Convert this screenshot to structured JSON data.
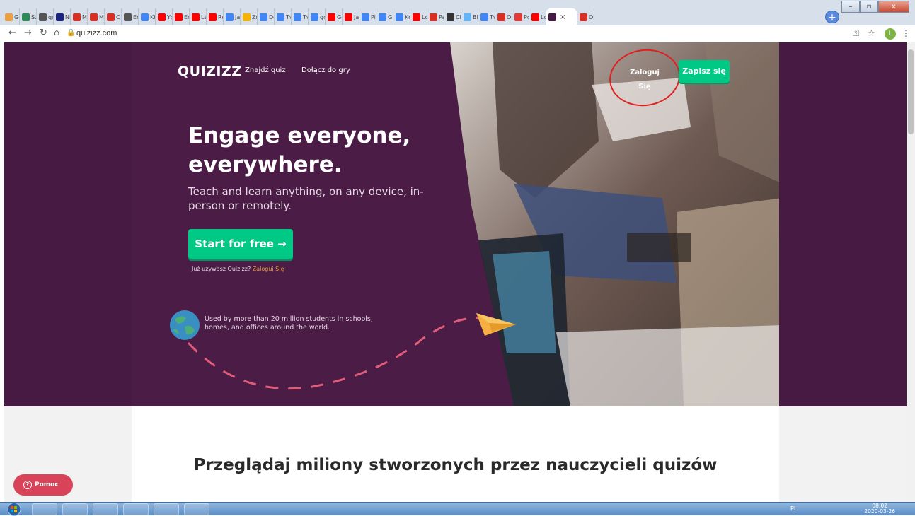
{
  "browser": {
    "tabs": [
      {
        "label": "Gc",
        "color": "#e8a040"
      },
      {
        "label": "Sz",
        "color": "#2e8b57"
      },
      {
        "label": "qu",
        "color": "#555555"
      },
      {
        "label": "Ni",
        "color": "#1a237e"
      },
      {
        "label": "M",
        "color": "#d93025"
      },
      {
        "label": "M",
        "color": "#d93025"
      },
      {
        "label": "Or",
        "color": "#d93025"
      },
      {
        "label": "En",
        "color": "#555555"
      },
      {
        "label": "Kt",
        "color": "#4285f4"
      },
      {
        "label": "Yc",
        "color": "#ff0000"
      },
      {
        "label": "En",
        "color": "#ff0000"
      },
      {
        "label": "Le",
        "color": "#ff0000"
      },
      {
        "label": "Rc",
        "color": "#ff0000"
      },
      {
        "label": "Jai",
        "color": "#4285f4"
      },
      {
        "label": "Zs",
        "color": "#f4b400"
      },
      {
        "label": "Dc",
        "color": "#4285f4"
      },
      {
        "label": "Tv",
        "color": "#4285f4"
      },
      {
        "label": "Tv",
        "color": "#4285f4"
      },
      {
        "label": "gc",
        "color": "#4285f4"
      },
      {
        "label": "Gc",
        "color": "#ff0000"
      },
      {
        "label": "Jai",
        "color": "#ff0000"
      },
      {
        "label": "Pi",
        "color": "#4285f4"
      },
      {
        "label": "G",
        "color": "#4285f4"
      },
      {
        "label": "Kc",
        "color": "#4285f4"
      },
      {
        "label": "Lc",
        "color": "#ff0000"
      },
      {
        "label": "Pa",
        "color": "#d93025"
      },
      {
        "label": "Cl",
        "color": "#333333"
      },
      {
        "label": "Bl",
        "color": "#64b5f6"
      },
      {
        "label": "Tv",
        "color": "#4285f4"
      },
      {
        "label": "Or",
        "color": "#d93025"
      },
      {
        "label": "Pc",
        "color": "#e53935"
      },
      {
        "label": "Lc",
        "color": "#ff0000"
      }
    ],
    "active_tab": {
      "label": "",
      "color": "#461a42",
      "close": "×"
    },
    "after_tab": {
      "label": "Or",
      "color": "#d93025"
    },
    "newtab_label": "+",
    "win_min": "–",
    "win_max": "▫",
    "win_close": "x",
    "url": "quizizz.com",
    "profile_initial": "L"
  },
  "header": {
    "logo": "QUIZIZZ",
    "nav": [
      "Znajdź quiz",
      "Dołącz do gry"
    ],
    "login": "Zaloguj Się",
    "signup": "Zapisz się"
  },
  "hero": {
    "headline": "Engage everyone, everywhere.",
    "subline": "Teach and learn anything, on any device, in-person or remotely.",
    "cta": "Start for free →",
    "already_text": "Już używasz Quizizz?",
    "already_link": "Zaloguj Się",
    "used_by": "Used by more than 20 million students in schools, homes, and offices around the world."
  },
  "section": {
    "browse_title": "Przeglądaj miliony stworzonych przez nauczycieli quizów"
  },
  "help": {
    "icon": "?",
    "label": "Pomoc"
  },
  "taskbar": {
    "lang": "PL",
    "time": "08:02",
    "date": "2020-03-26"
  },
  "colors": {
    "brand_purple": "#461a42",
    "accent_green": "#00c985",
    "help_red": "#d9435a",
    "link_orange": "#f0a030"
  }
}
